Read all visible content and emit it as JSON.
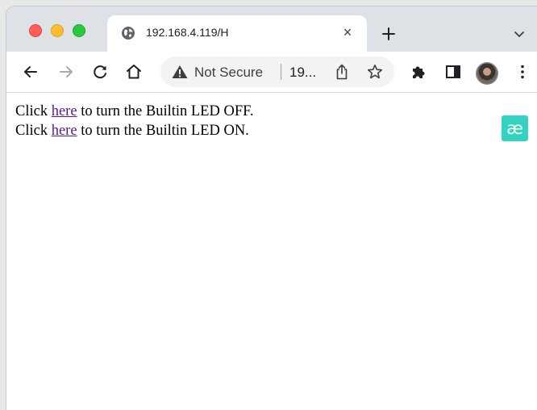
{
  "browser": {
    "tab": {
      "title": "192.168.4.119/H",
      "close_glyph": "×",
      "favicon": "globe-icon"
    },
    "new_tab_icon": "plus-icon",
    "tab_search_icon": "chevron-down-icon",
    "toolbar": {
      "back_icon": "arrow-left-icon",
      "forward_icon": "arrow-right-icon",
      "reload_icon": "reload-icon",
      "home_icon": "home-icon",
      "security_label": "Not Secure",
      "url_display": "19...",
      "share_icon": "share-icon",
      "bookmark_icon": "star-icon",
      "extensions_icon": "puzzle-icon",
      "side_panel_icon": "side-panel-icon",
      "profile_icon": "avatar",
      "menu_icon": "kebab-menu-icon"
    }
  },
  "page": {
    "lines": [
      {
        "prefix": "Click ",
        "link": "here",
        "suffix": " to turn the Builtin LED OFF."
      },
      {
        "prefix": "Click ",
        "link": "here",
        "suffix": " to turn the Builtin LED ON."
      }
    ],
    "extension_badge": "æ"
  },
  "colors": {
    "link_visited": "#551a8b",
    "badge_bg": "#33d3c2",
    "titlebar_bg": "#dee1e6",
    "omnibox_bg": "#f1f3f4"
  }
}
